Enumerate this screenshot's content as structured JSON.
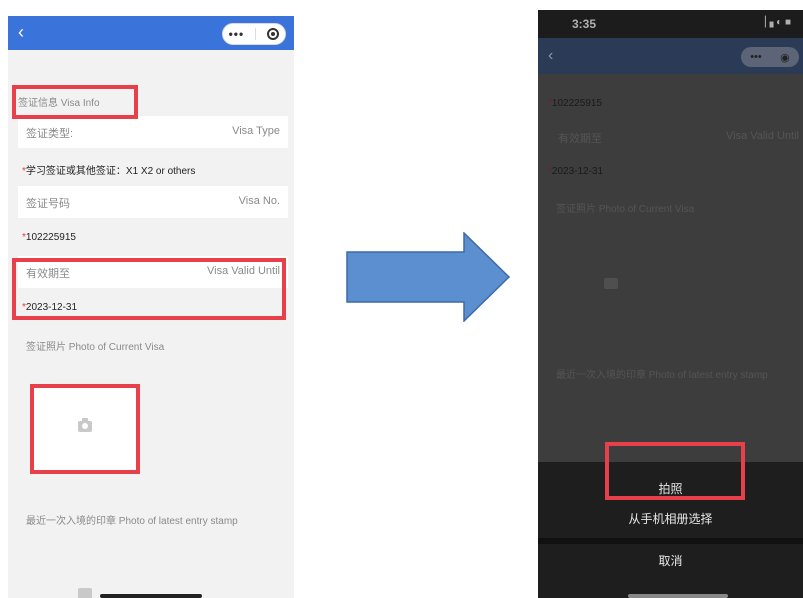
{
  "left": {
    "back_glyph": "‹",
    "menu_dots": "•••",
    "section_title": "签证信息 Visa Info",
    "visa_type": {
      "label": "签证类型:",
      "label_en": "Visa Type",
      "value": "学习签证或其他签证：X1 X2 or others"
    },
    "visa_no": {
      "label": "签证号码",
      "label_en": "Visa No.",
      "value": "102225915"
    },
    "valid_until": {
      "label": "有效期至",
      "label_en": "Visa Valid Until",
      "value": "2023-12-31"
    },
    "required_mark": "*",
    "photo_label": "签证照片 Photo of Current Visa",
    "stamp_label": "最近一次入境的印章 Photo of latest entry stamp",
    "camera_icon": "camera-icon"
  },
  "right": {
    "status_time": "3:35",
    "status_icons": "▕▗ ◐ ■",
    "menu_dots": "•••",
    "visa_no_value": "102225915",
    "valid_label": "有效期至",
    "valid_label_en": "Visa Valid Until",
    "valid_value": "2023-12-31",
    "photo_label": "签证照片 Photo of Current Visa",
    "stamp_label": "最近一次入境的印章 Photo of latest entry stamp",
    "sheet": {
      "take_photo": "拍照",
      "choose_album": "从手机相册选择",
      "cancel": "取消"
    }
  },
  "colors": {
    "nav_blue": "#3a73d9",
    "highlight_red": "#e8404a",
    "arrow_blue": "#5b8fd0"
  }
}
